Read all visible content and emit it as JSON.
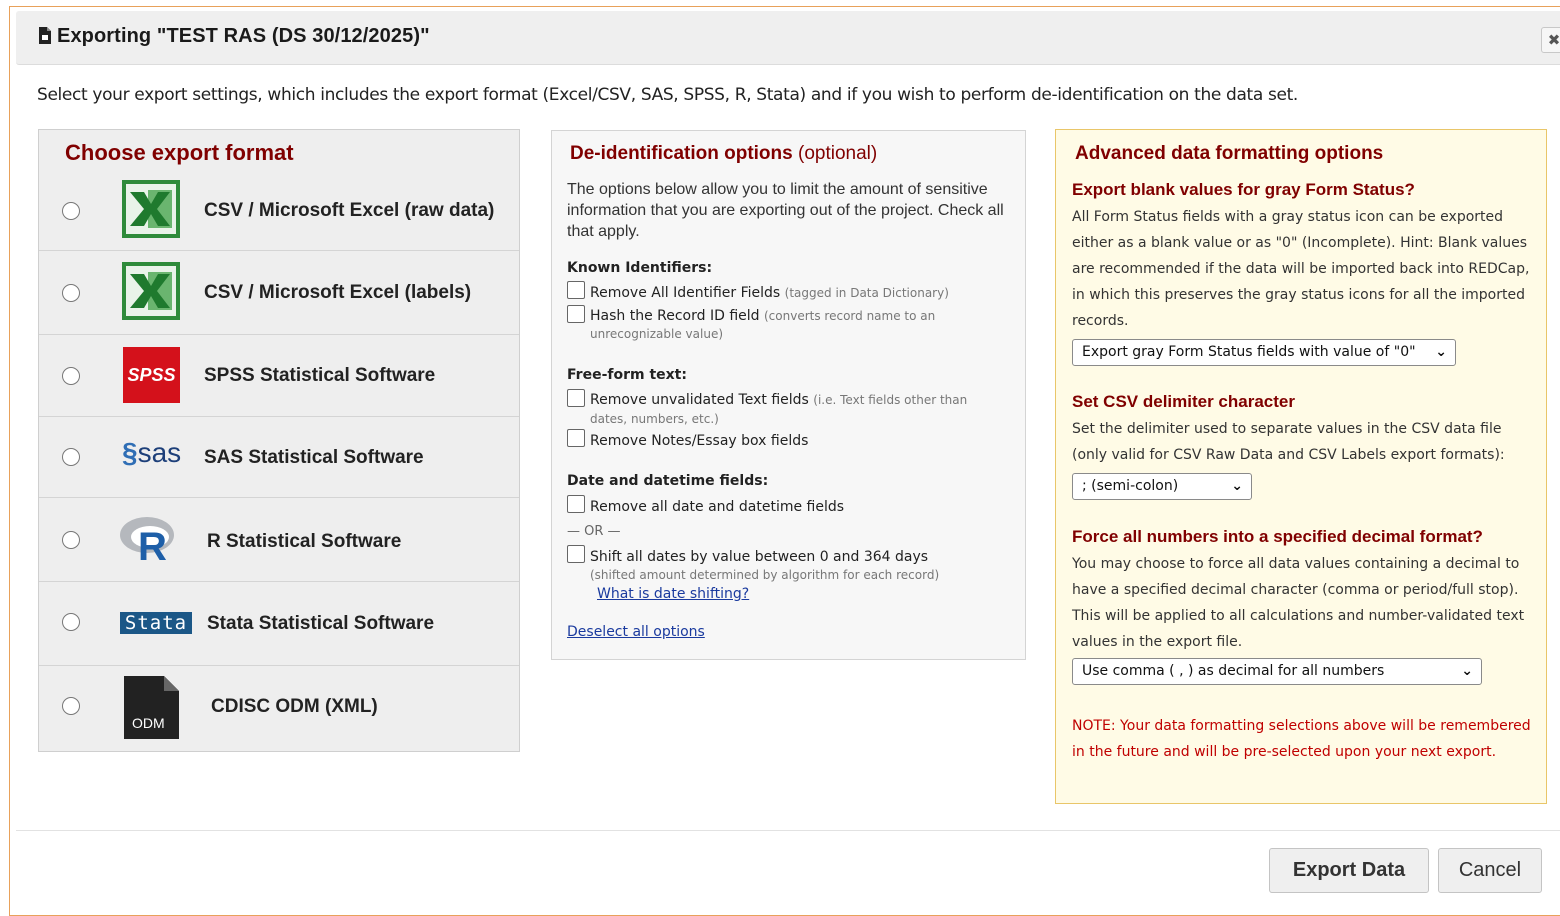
{
  "dialog": {
    "title": "Exporting \"TEST RAS (DS 30/12/2025)\"",
    "close_label": "✖",
    "intro": "Select your export settings, which includes the export format (Excel/CSV, SAS, SPSS, R, Stata) and if you wish to perform de-identification on the data set."
  },
  "formats": {
    "title": "Choose export format",
    "items": [
      {
        "label": "CSV / Microsoft Excel (raw data)",
        "icon": "excel-icon"
      },
      {
        "label": "CSV / Microsoft Excel (labels)",
        "icon": "excel-icon"
      },
      {
        "label": "SPSS Statistical Software",
        "icon": "spss-icon",
        "icon_text": "SPSS"
      },
      {
        "label": "SAS Statistical Software",
        "icon": "sas-icon",
        "icon_text": "sas"
      },
      {
        "label": "R Statistical Software",
        "icon": "r-icon",
        "icon_text": "R"
      },
      {
        "label": "Stata Statistical Software",
        "icon": "stata-icon",
        "icon_text": "Stata"
      },
      {
        "label": "CDISC ODM (XML)",
        "icon": "odm-file-icon",
        "icon_text": "ODM"
      }
    ]
  },
  "deid": {
    "title": "De-identification options",
    "optional": "(optional)",
    "desc": "The options below allow you to limit the amount of sensitive information that you are exporting out of the project. Check all that apply.",
    "known_head": "Known Identifiers:",
    "remove_identifiers": "Remove All Identifier Fields",
    "remove_identifiers_note": "(tagged in Data Dictionary)",
    "hash_record": "Hash the Record ID field",
    "hash_record_note": "(converts record name to an",
    "hash_record_note2": "unrecognizable value)",
    "freeform_head": "Free-form text:",
    "remove_text": "Remove unvalidated Text fields",
    "remove_text_note": "(i.e. Text fields other than",
    "remove_text_note2": "dates, numbers, etc.)",
    "remove_notes": "Remove Notes/Essay box fields",
    "date_head": "Date and datetime fields:",
    "remove_dates": "Remove all date and datetime fields",
    "or": "— OR —",
    "shift_dates": "Shift all dates by value between 0 and 364 days",
    "shift_note": "(shifted amount determined by algorithm for each record)",
    "shift_link": "What is date shifting?",
    "deselect": "Deselect all options"
  },
  "advanced": {
    "title": "Advanced data formatting options",
    "blank_head": "Export blank values for gray Form Status?",
    "blank_text": "All Form Status fields with a gray status icon can be exported either as a blank value or as \"0\" (Incomplete). Hint: Blank values are recommended if the data will be imported back into REDCap, in which this preserves the gray status icons for all the imported records.",
    "blank_select": "Export gray Form Status fields with value of \"0\"",
    "delim_head": "Set CSV delimiter character",
    "delim_text": "Set the delimiter used to separate values in the CSV data file (only valid for CSV Raw Data and CSV Labels export formats):",
    "delim_select": "; (semi-colon)",
    "decimal_head": "Force all numbers into a specified decimal format?",
    "decimal_text": "You may choose to force all data values containing a decimal to have a specified decimal character (comma or period/full stop). This will be applied to all calculations and number-validated text values in the export file.",
    "decimal_select": "Use comma ( , ) as decimal for all numbers",
    "note": "NOTE: Your data formatting selections above will be remembered in the future and will be pre-selected upon your next export."
  },
  "footer": {
    "export_label": "Export Data",
    "cancel_label": "Cancel"
  },
  "colors": {
    "heading_maroon": "#800000",
    "note_red": "#c00000",
    "advanced_bg": "#fffbe6",
    "dialog_border": "#e8a15a"
  }
}
